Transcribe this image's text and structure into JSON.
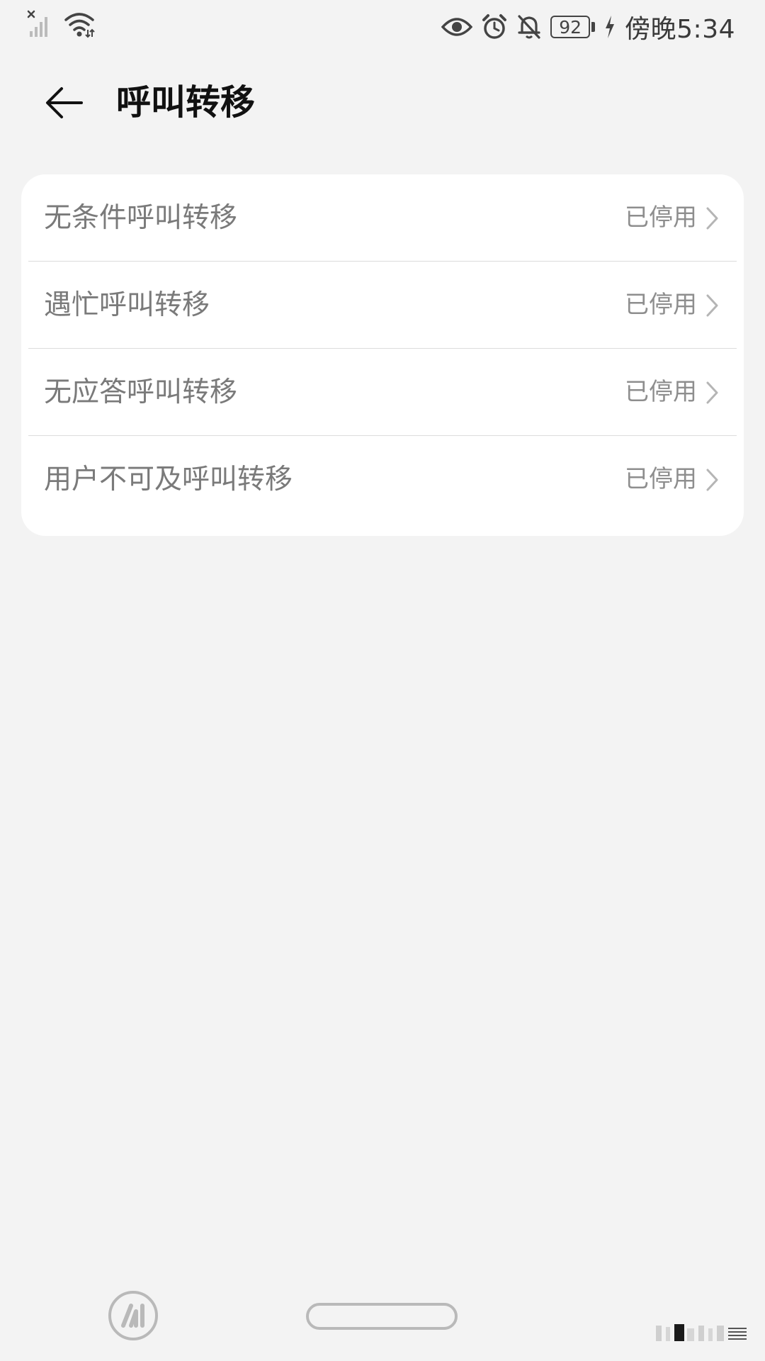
{
  "status_bar": {
    "time": "傍晚5:34",
    "battery": "92",
    "icons": [
      "signal-icon",
      "wifi-icon",
      "eye-icon",
      "alarm-icon",
      "mute-bell-icon",
      "battery-icon",
      "charging-icon"
    ]
  },
  "header": {
    "title": "呼叫转移",
    "back_icon": "arrow-left-icon"
  },
  "settings": {
    "items": [
      {
        "label": "无条件呼叫转移",
        "value": "已停用"
      },
      {
        "label": "遇忙呼叫转移",
        "value": "已停用"
      },
      {
        "label": "无应答呼叫转移",
        "value": "已停用"
      },
      {
        "label": "用户不可及呼叫转移",
        "value": "已停用"
      }
    ]
  },
  "colors": {
    "background": "#f3f3f3",
    "card": "#ffffff",
    "label_text": "#7a7a7a",
    "value_text": "#8e8e8e",
    "title_text": "#111111"
  }
}
